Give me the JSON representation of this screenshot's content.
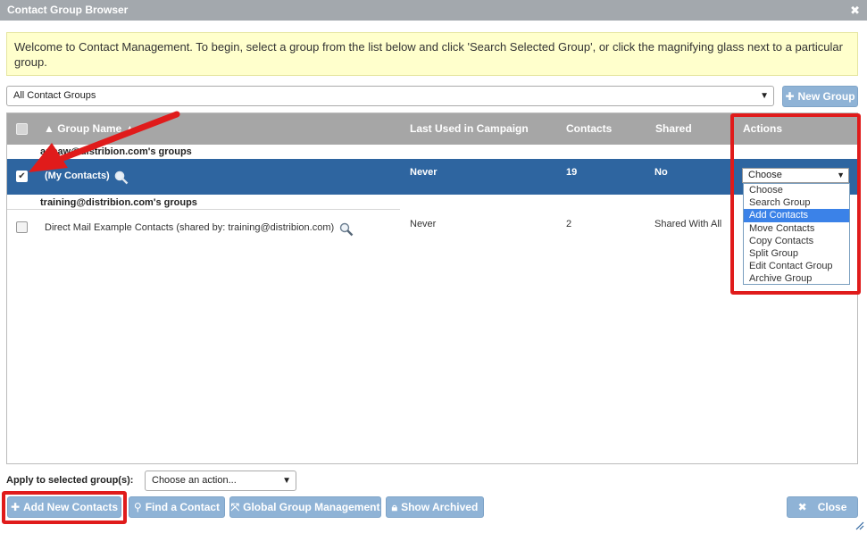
{
  "window": {
    "title": "Contact Group Browser",
    "close_glyph": "✖"
  },
  "welcome_text": "Welcome to Contact Management. To begin, select a group from the list below and click 'Search Selected Group', or click the magnifying glass next to a particular group.",
  "group_filter": {
    "selected": "All Contact Groups"
  },
  "new_group_button": {
    "label": "New Group",
    "icon": "plus-icon"
  },
  "table": {
    "headers": {
      "group_name": "▲ Group Name ▲",
      "last_used": "Last Used in Campaign",
      "contacts": "Contacts",
      "shared": "Shared",
      "actions": "Actions"
    },
    "sections": [
      {
        "heading": "annaw@distribion.com's groups",
        "rows": [
          {
            "name": "(My Contacts)",
            "last_used": "Never",
            "contacts": "19",
            "shared": "No",
            "selected": true,
            "action": "Choose"
          }
        ]
      },
      {
        "heading": "training@distribion.com's groups",
        "rows": [
          {
            "name": "Direct Mail Example Contacts (shared by: training@distribion.com)",
            "last_used": "Never",
            "contacts": "2",
            "shared": "Shared With All",
            "selected": false
          }
        ]
      }
    ]
  },
  "actions_dropdown": {
    "options": [
      "Choose",
      "Search Group",
      "Add Contacts",
      "Move Contacts",
      "Copy Contacts",
      "Split Group",
      "Edit Contact Group",
      "Archive Group"
    ],
    "highlighted": "Add Contacts"
  },
  "apply": {
    "label": "Apply to selected group(s):",
    "selected": "Choose an action..."
  },
  "footer_buttons": {
    "add_new_contacts": "Add New Contacts",
    "find_contact": "Find a Contact",
    "global_group_management": "Global Group Management",
    "show_archived": "Show Archived",
    "close": "Close"
  },
  "colors": {
    "selected_row": "#2e65a0",
    "button": "#8fb3d6",
    "highlight_red": "#e01b1b",
    "dropdown_highlight": "#3b82e8",
    "welcome_bg": "#ffffcc"
  }
}
